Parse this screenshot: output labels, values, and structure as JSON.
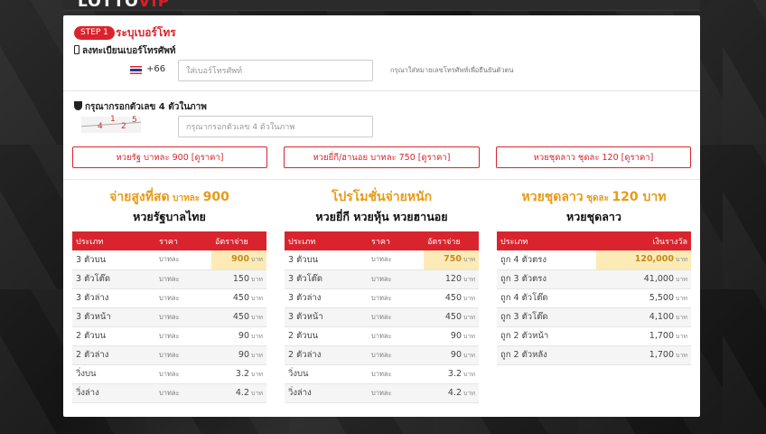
{
  "brand": {
    "logo_main": "LOTTO",
    "logo_accent": "VIP"
  },
  "step": {
    "badge": "STEP 1",
    "title": "ระบุเบอร์โทร"
  },
  "phone": {
    "label": "ลงทะเบียนเบอร์โทรศัพท์",
    "country_code": "+66",
    "placeholder": "ใส่เบอร์โทรศัพท์",
    "hint": "กรุณาใส่หมายเลขโทรศัพท์เพื่อยืนยันตัวตน"
  },
  "captcha": {
    "label": "กรุณากรอกตัวเลข 4 ตัวในภาพ",
    "digits": [
      "4",
      "1",
      "2",
      "5"
    ],
    "placeholder": "กรุณากรอกตัวเลข 4 ตัวในภาพ"
  },
  "price_buttons": [
    "หวยรัฐ บาทละ 900 [ดูราคา]",
    "หวยยี่กี/ฮานอย บาทละ 750 [ดูราคา]",
    "หวยชุดลาว ชุดละ 120 [ดูราคา]"
  ],
  "columns": [
    {
      "title": "จ่ายสูงที่สด",
      "title_small": " บาทละ ",
      "title_value": "900",
      "subtitle": "หวยรัฐบาลไทย",
      "headers": [
        "ประเภท",
        "ราคา",
        "อัตราจ่าย"
      ],
      "rows": [
        [
          "3 ตัวบน",
          "บาทละ",
          "900",
          "บาท"
        ],
        [
          "3 ตัวโต๊ด",
          "บาทละ",
          "150",
          "บาท"
        ],
        [
          "3 ตัวล่าง",
          "บาทละ",
          "450",
          "บาท"
        ],
        [
          "3 ตัวหน้า",
          "บาทละ",
          "450",
          "บาท"
        ],
        [
          "2 ตัวบน",
          "บาทละ",
          "90",
          "บาท"
        ],
        [
          "2 ตัวล่าง",
          "บาทละ",
          "90",
          "บาท"
        ],
        [
          "วิ่งบน",
          "บาทละ",
          "3.2",
          "บาท"
        ],
        [
          "วิ่งล่าง",
          "บาทละ",
          "4.2",
          "บาท"
        ]
      ]
    },
    {
      "title": "โปรโมชั่นจ่ายหนัก",
      "title_small": "",
      "title_value": "",
      "subtitle": "หวยยี่กี หวยหุ้น หวยฮานอย",
      "headers": [
        "ประเภท",
        "ราคา",
        "อัตราจ่าย"
      ],
      "rows": [
        [
          "3 ตัวบน",
          "บาทละ",
          "750",
          "บาท"
        ],
        [
          "3 ตัวโต๊ด",
          "บาทละ",
          "120",
          "บาท"
        ],
        [
          "3 ตัวล่าง",
          "บาทละ",
          "450",
          "บาท"
        ],
        [
          "3 ตัวหน้า",
          "บาทละ",
          "450",
          "บาท"
        ],
        [
          "2 ตัวบน",
          "บาทละ",
          "90",
          "บาท"
        ],
        [
          "2 ตัวล่าง",
          "บาทละ",
          "90",
          "บาท"
        ],
        [
          "วิ่งบน",
          "บาทละ",
          "3.2",
          "บาท"
        ],
        [
          "วิ่งล่าง",
          "บาทละ",
          "4.2",
          "บาท"
        ]
      ]
    },
    {
      "title": "หวยชุดลาว",
      "title_small": " ชุดละ ",
      "title_value": "120 บาท",
      "subtitle": "หวยชุดลาว",
      "headers": [
        "ประเภท",
        "",
        "เงินรางวัล"
      ],
      "rows": [
        [
          "ถูก 4 ตัวตรง",
          "",
          "120,000",
          "บาท"
        ],
        [
          "ถูก 3 ตัวตรง",
          "",
          "41,000",
          "บาท"
        ],
        [
          "ถูก 4 ตัวโต๊ด",
          "",
          "5,500",
          "บาท"
        ],
        [
          "ถูก 3 ตัวโต๊ด",
          "",
          "4,100",
          "บาท"
        ],
        [
          "ถูก 2 ตัวหน้า",
          "",
          "1,700",
          "บาท"
        ],
        [
          "ถูก 2 ตัวหลัง",
          "",
          "1,700",
          "บาท"
        ]
      ]
    }
  ]
}
